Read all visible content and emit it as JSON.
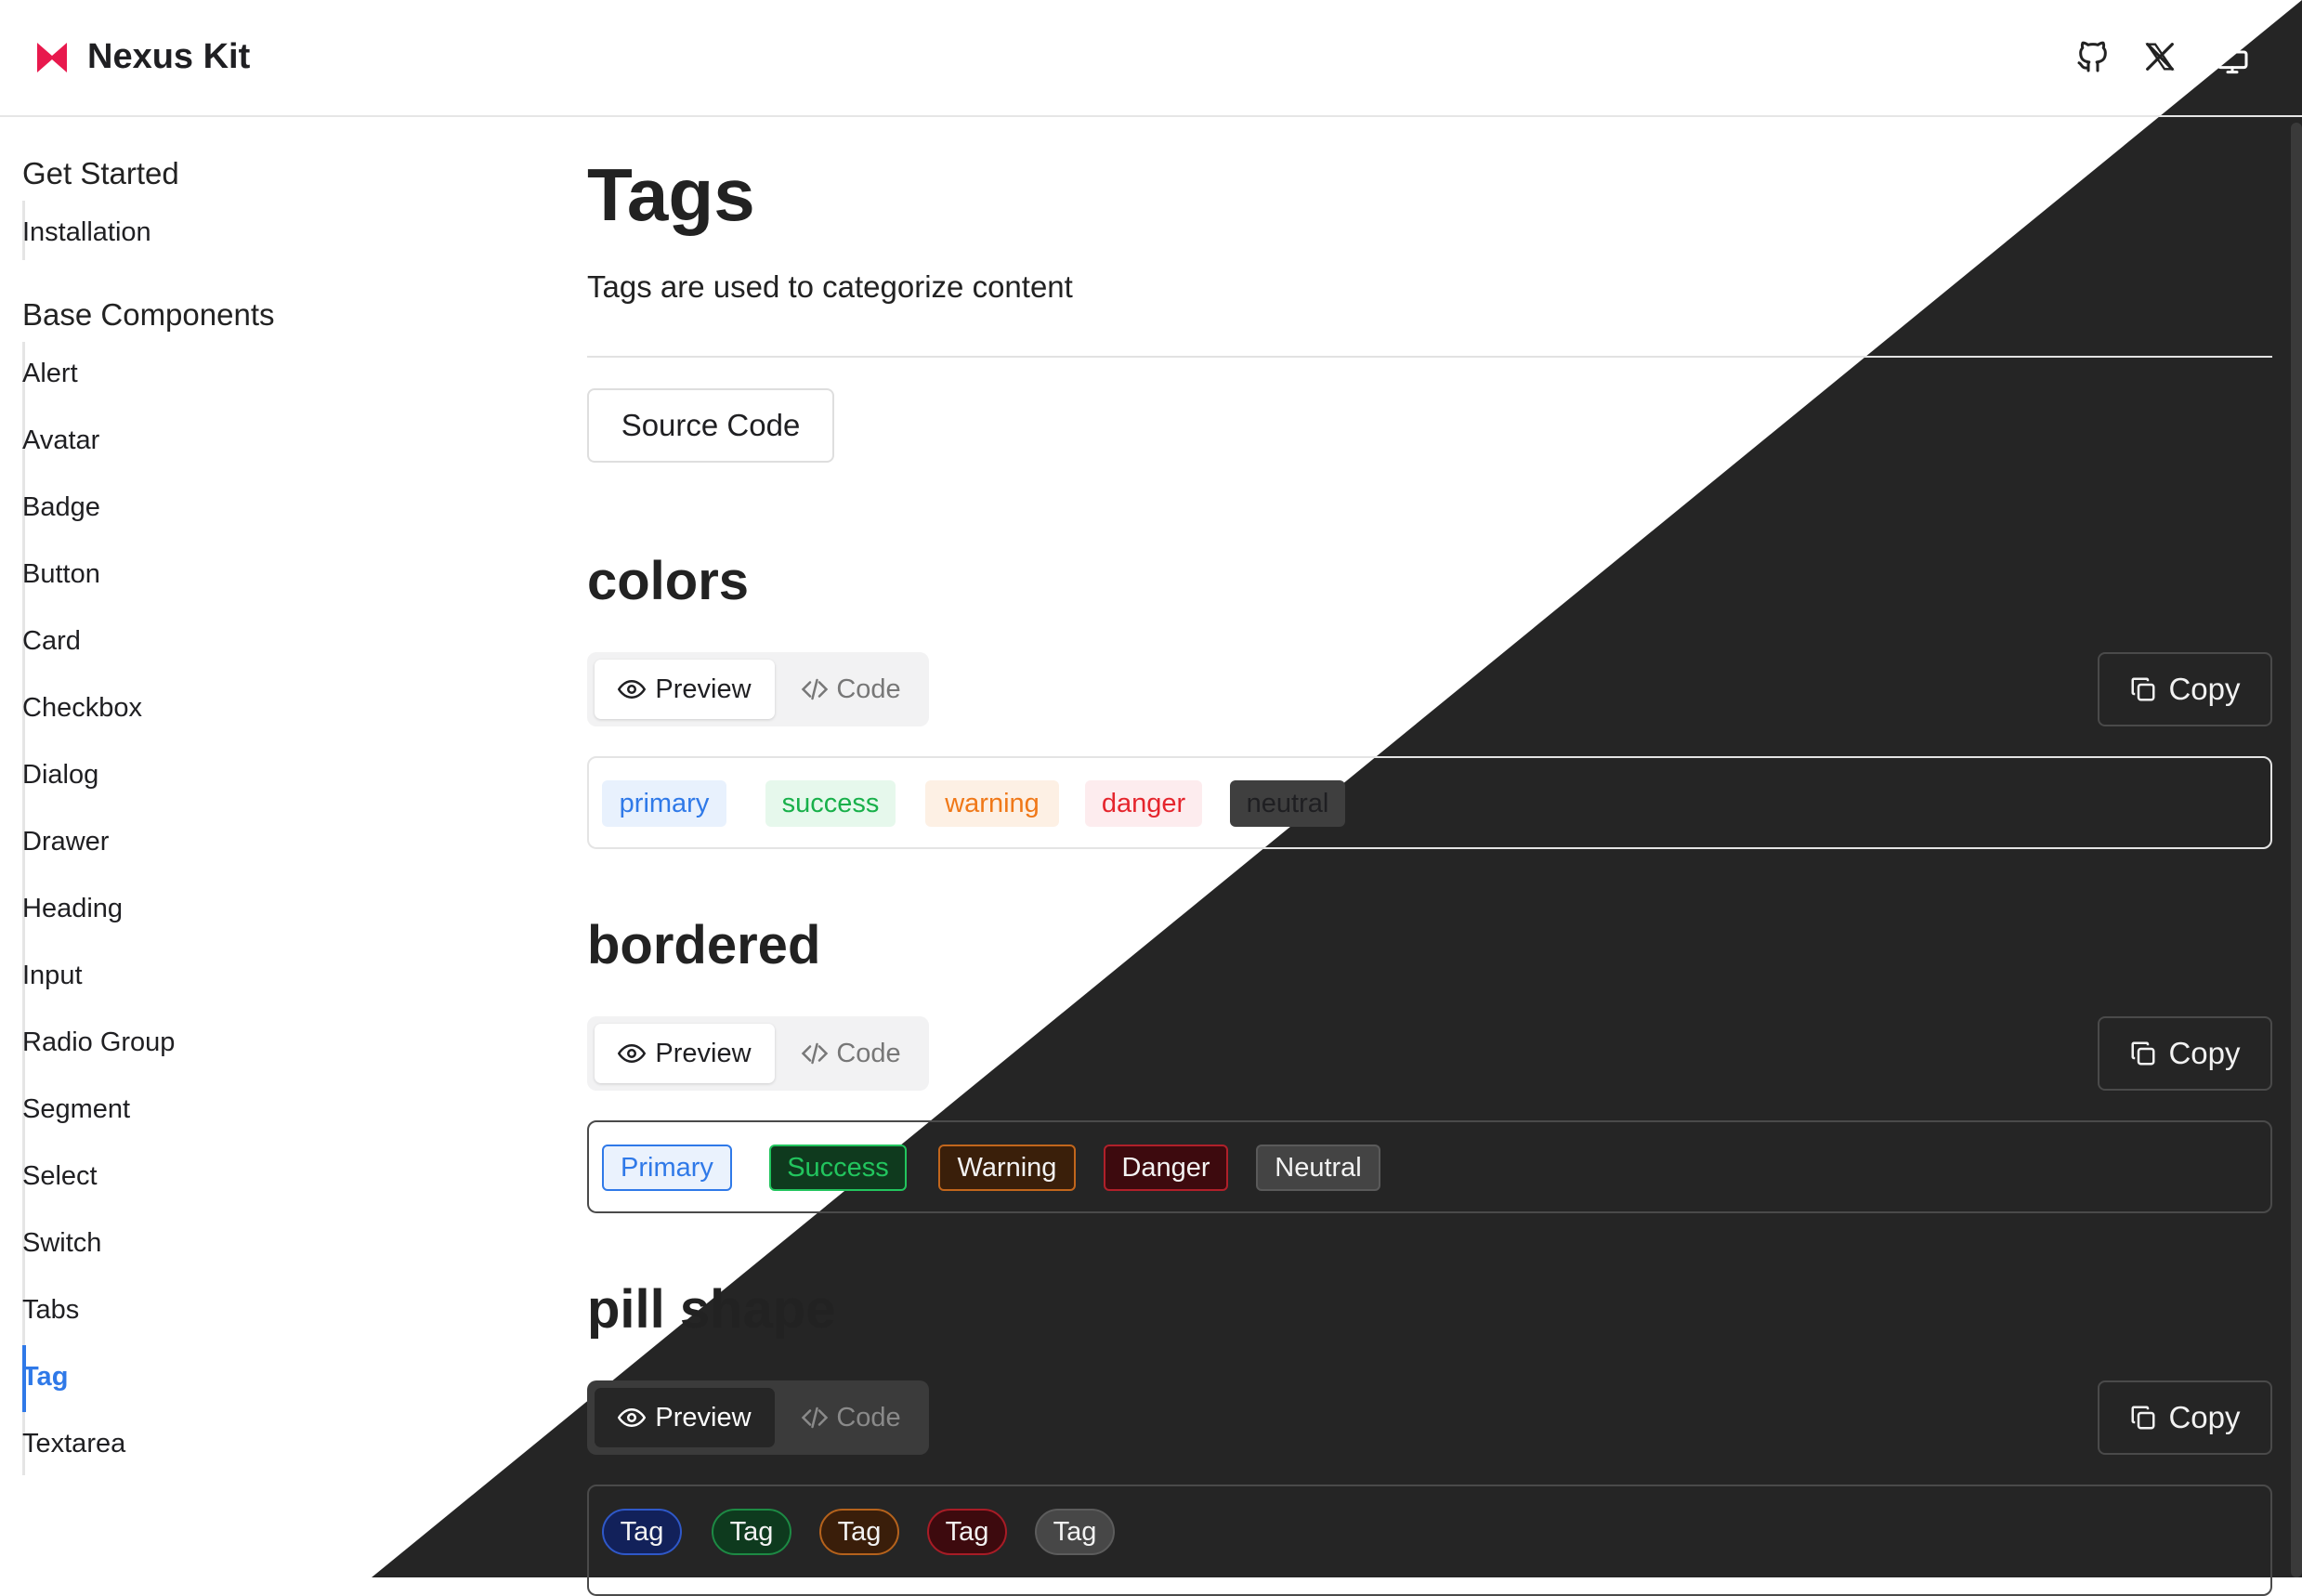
{
  "header": {
    "brand_name": "Nexus Kit",
    "brand_color": "#e8194d",
    "icons": [
      "github-icon",
      "x-twitter-icon",
      "theme-toggle-icon"
    ]
  },
  "sidebar": {
    "groups": [
      {
        "title": "Get Started",
        "items": [
          "Installation"
        ]
      },
      {
        "title": "Base Components",
        "items": [
          "Alert",
          "Avatar",
          "Badge",
          "Button",
          "Card",
          "Checkbox",
          "Dialog",
          "Drawer",
          "Heading",
          "Input",
          "Radio Group",
          "Segment",
          "Select",
          "Switch",
          "Tabs",
          "Tag",
          "Textarea"
        ]
      }
    ],
    "active_item": "Tag",
    "accent_color": "#2f79e8"
  },
  "main": {
    "title": "Tags",
    "description": "Tags are used to categorize content",
    "source_button": "Source Code",
    "sections": [
      {
        "title": "colors",
        "tabs": {
          "preview": "Preview",
          "code": "Code"
        },
        "copy": "Copy",
        "tags": [
          "primary",
          "success",
          "warning",
          "danger",
          "neutral"
        ]
      },
      {
        "title": "bordered",
        "tabs": {
          "preview": "Preview",
          "code": "Code"
        },
        "copy": "Copy",
        "tags": [
          "Primary",
          "Success",
          "Warning",
          "Danger",
          "Neutral"
        ]
      },
      {
        "title": "pill shape",
        "tabs": {
          "preview": "Preview",
          "code": "Code"
        },
        "copy": "Copy",
        "tags": [
          "Tag",
          "Tag",
          "Tag",
          "Tag",
          "Tag"
        ]
      }
    ]
  },
  "theme": {
    "light_bg": "#ffffff",
    "dark_bg": "#252525"
  }
}
